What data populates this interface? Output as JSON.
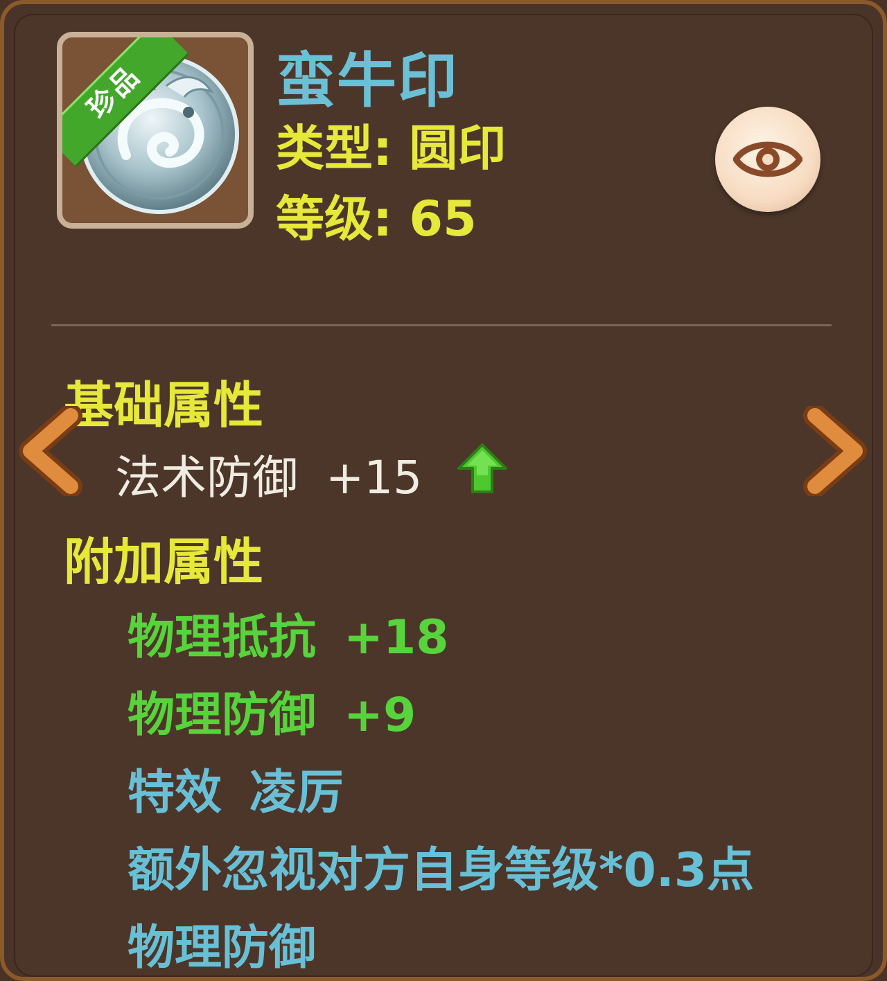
{
  "item": {
    "rarity": "珍品",
    "name": "蛮牛印",
    "type_label": "类型:",
    "type_value": "圆印",
    "level_label": "等级:",
    "level_value": "65"
  },
  "buttons": {
    "view_icon": "eye-icon",
    "prev_icon": "chevron-left-icon",
    "next_icon": "chevron-right-icon"
  },
  "base_attributes": {
    "title": "基础属性",
    "items": [
      {
        "name": "法术防御",
        "value": "+15",
        "indicator": "up-arrow-icon"
      }
    ]
  },
  "extra_attributes": {
    "title": "附加属性",
    "green_items": [
      {
        "name": "物理抵抗",
        "value": "+18"
      },
      {
        "name": "物理防御",
        "value": "+9"
      }
    ],
    "effect": {
      "label": "特效",
      "name": "凌厉",
      "description": "额外忽视对方自身等级*0.3点",
      "description2": "物理防御"
    }
  },
  "colors": {
    "panel_bg": "#4c362a",
    "frame": "#8b5a2b",
    "name": "#6cc0d6",
    "yellow": "#e6e83a",
    "green": "#57d33c",
    "blue": "#68c0d7",
    "white": "#f1ece2",
    "rarity_ribbon": "#43a72c"
  }
}
